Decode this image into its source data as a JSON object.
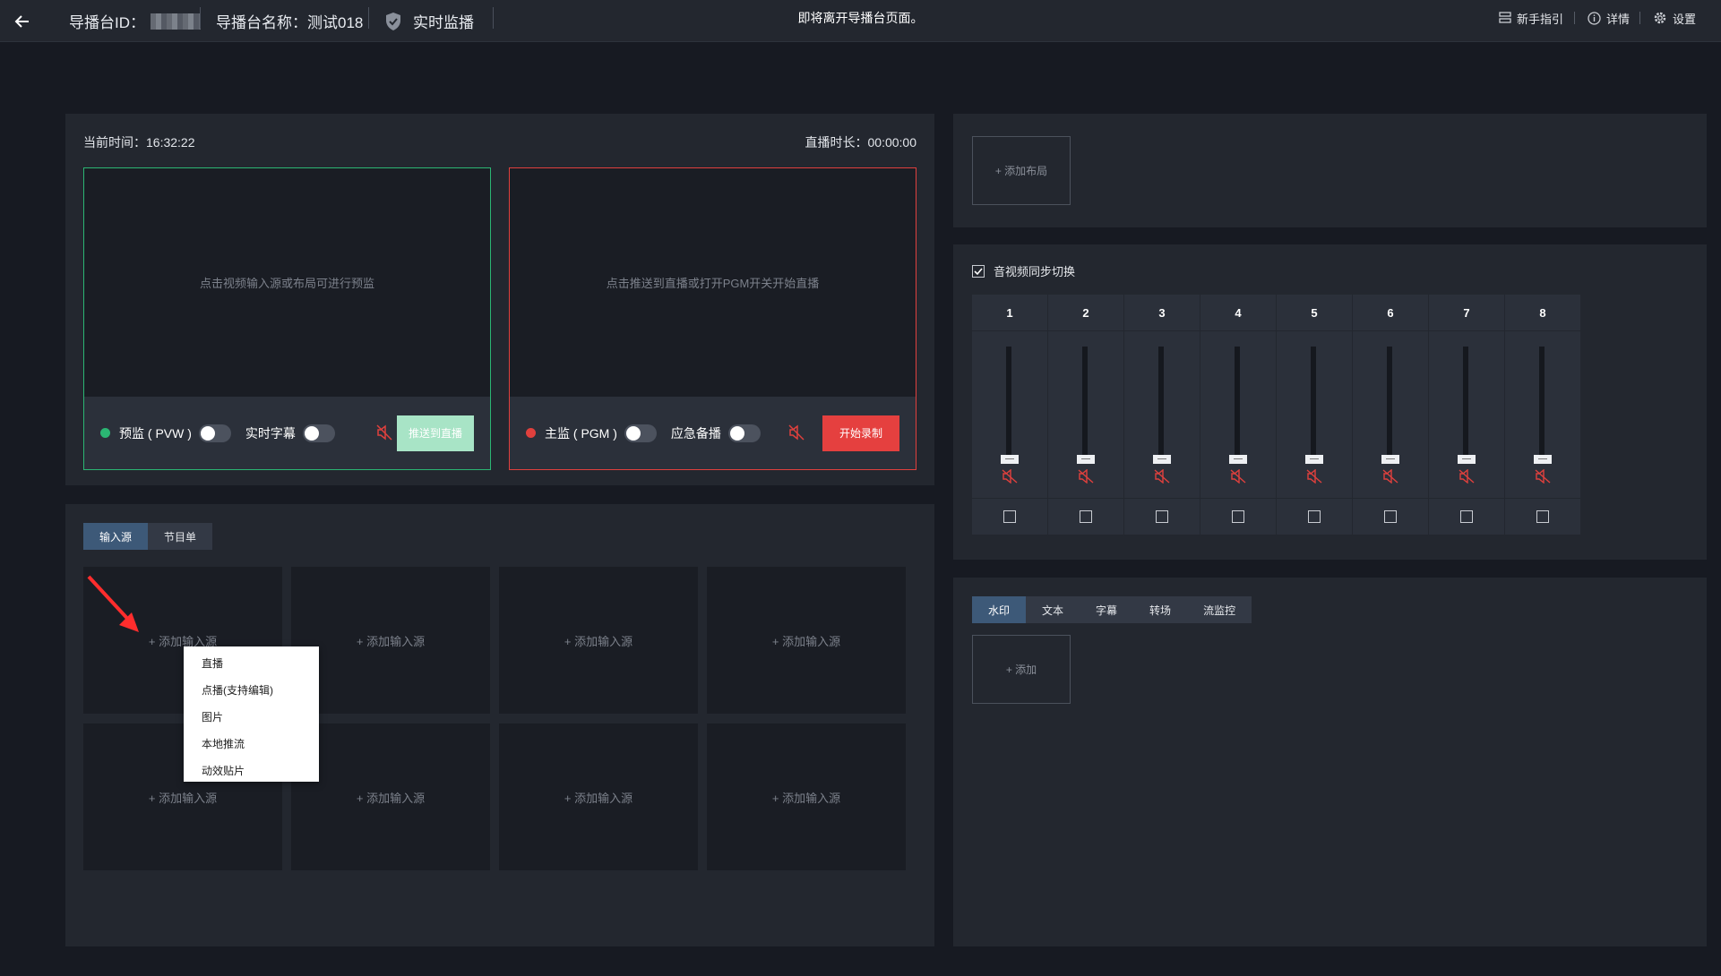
{
  "topbar": {
    "id_label": "导播台ID：",
    "name_label": "导播台名称：",
    "name_value": "测试018",
    "monitor_label": "实时监播",
    "center_message": "即将离开导播台页面。",
    "guide_label": "新手指引",
    "detail_label": "详情",
    "settings_label": "设置"
  },
  "monitor": {
    "current_time_label": "当前时间：",
    "current_time": "16:32:22",
    "live_duration_label": "直播时长：",
    "live_duration": "00:00:00",
    "pvw": {
      "hint": "点击视频输入源或布局可进行预监",
      "label": "预监 ( PVW )",
      "subtitle_label": "实时字幕",
      "push_button": "推送到直播",
      "dot_color": "#2bb673"
    },
    "pgm": {
      "hint": "点击推送到直播或打开PGM开关开始直播",
      "label": "主监 ( PGM )",
      "backup_label": "应急备播",
      "record_button": "开始录制",
      "dot_color": "#e0403d"
    }
  },
  "sources": {
    "tabs": [
      "输入源",
      "节目单"
    ],
    "active_tab": "输入源",
    "add_label": "+ 添加输入源",
    "menu_items": [
      "直播",
      "点播(支持编辑)",
      "图片",
      "本地推流",
      "动效贴片"
    ]
  },
  "layout": {
    "add_label": "+ 添加布局"
  },
  "audio": {
    "sync_label": "音视频同步切换",
    "sync_checked": true,
    "channels": [
      "1",
      "2",
      "3",
      "4",
      "5",
      "6",
      "7",
      "8"
    ]
  },
  "effects": {
    "tabs": [
      "水印",
      "文本",
      "字幕",
      "转场",
      "流监控"
    ],
    "active_tab": "水印",
    "add_label": "+ 添加"
  }
}
